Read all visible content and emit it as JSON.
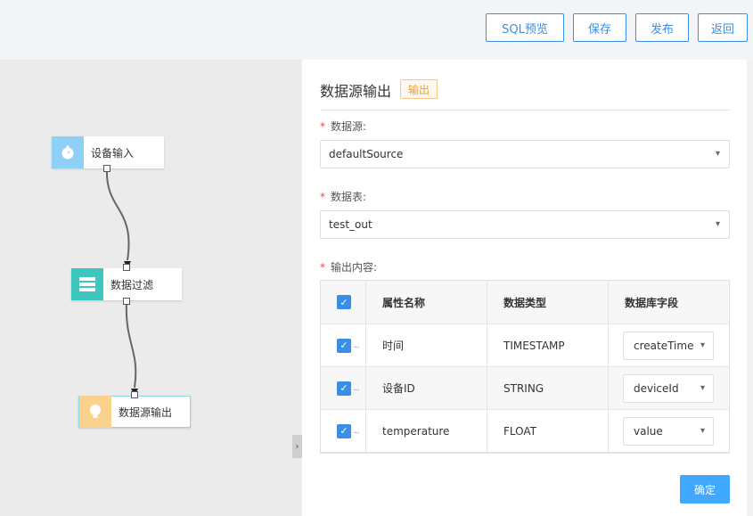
{
  "toolbar": {
    "sql_preview": "SQL预览",
    "save": "保存",
    "publish": "发布",
    "back": "返回"
  },
  "canvas": {
    "nodes": [
      {
        "label": "设备输入",
        "icon": "timer-icon"
      },
      {
        "label": "数据过滤",
        "icon": "layers-icon"
      },
      {
        "label": "数据源输出",
        "icon": "bulb-icon"
      }
    ]
  },
  "panel": {
    "title": "数据源输出",
    "badge": "输出",
    "source_label": "数据源:",
    "source_value": "defaultSource",
    "table_label": "数据表:",
    "table_value": "test_out",
    "output_label": "输出内容:",
    "grid": {
      "headers": [
        "属性名称",
        "数据类型",
        "数据库字段"
      ],
      "rows": [
        {
          "name": "时间",
          "type": "TIMESTAMP",
          "field": "createTime"
        },
        {
          "name": "设备ID",
          "type": "STRING",
          "field": "deviceId"
        },
        {
          "name": "temperature",
          "type": "FLOAT",
          "field": "value"
        }
      ]
    },
    "confirm": "确定"
  },
  "colors": {
    "accent": "#3a8ee6",
    "confirm": "#40a9ff",
    "badge": "#f39c2f",
    "required": "#e74c3c"
  }
}
